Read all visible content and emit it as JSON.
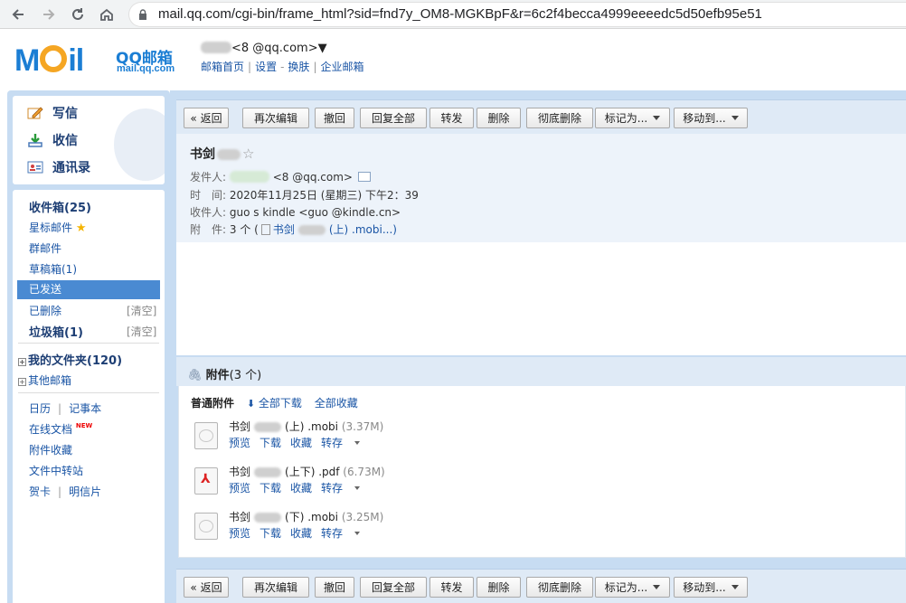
{
  "browser": {
    "url": "mail.qq.com/cgi-bin/frame_html?sid=fnd7y_OM8-MGKBpF&r=6c2f4becca4999eeeedc5d50efb95e51"
  },
  "header": {
    "logo_text": "MOil",
    "product_name": "QQ邮箱",
    "product_url": "mail.qq.com",
    "account": "<8          @qq.com>▼",
    "links": [
      "邮箱首页",
      "设置",
      "换肤",
      "企业邮箱"
    ]
  },
  "quick_actions": [
    "写信",
    "收信",
    "通讯录"
  ],
  "folders": {
    "inbox": "收件箱(25)",
    "starred": "星标邮件",
    "group": "群邮件",
    "drafts": "草稿箱(1)",
    "sent": "已发送",
    "deleted": "已删除",
    "spam": "垃圾箱(1)",
    "clear_label": "[清空]",
    "my_folders": "我的文件夹(120)",
    "other_mailboxes": "其他邮箱",
    "calendar": "日历",
    "notes": "记事本",
    "online_docs": "在线文档",
    "new_badge": "NEW",
    "attachments": "附件收藏",
    "file_transfer": "文件中转站",
    "cards": "贺卡",
    "postcards": "明信片"
  },
  "toolbar": {
    "back": "« 返回",
    "reedit": "再次编辑",
    "recall": "撤回",
    "reply_all": "回复全部",
    "forward": "转发",
    "delete": "删除",
    "delete_forever": "彻底删除",
    "mark_as": "标记为...",
    "move_to": "移动到..."
  },
  "mail": {
    "subject": "书剑",
    "star": "☆",
    "from_label": "发件人:",
    "from_value": "<8          @qq.com>",
    "time_label": "时　间:",
    "time_value": "2020年11月25日 (星期三) 下午2：39",
    "to_label": "收件人:",
    "to_value": "guo          s kindle <guo          @kindle.cn>",
    "attach_label": "附　件:",
    "attach_value": "3 个 (",
    "attach_first": "书剑",
    "attach_first_suffix": "(上) .mobi...)"
  },
  "attachments": {
    "title": "附件",
    "count": "(3 个)",
    "section_label": "普通附件",
    "download_all": "全部下载",
    "save_all": "全部收藏",
    "actions": [
      "预览",
      "下载",
      "收藏",
      "转存"
    ],
    "items": [
      {
        "name": "书剑",
        "part": "(上) .mobi",
        "size": "(3.37M)"
      },
      {
        "name": "书剑",
        "part": "(上下) .pdf",
        "size": "(6.73M)"
      },
      {
        "name": "书剑",
        "part": "(下) .mobi",
        "size": "(3.25M)"
      }
    ]
  }
}
